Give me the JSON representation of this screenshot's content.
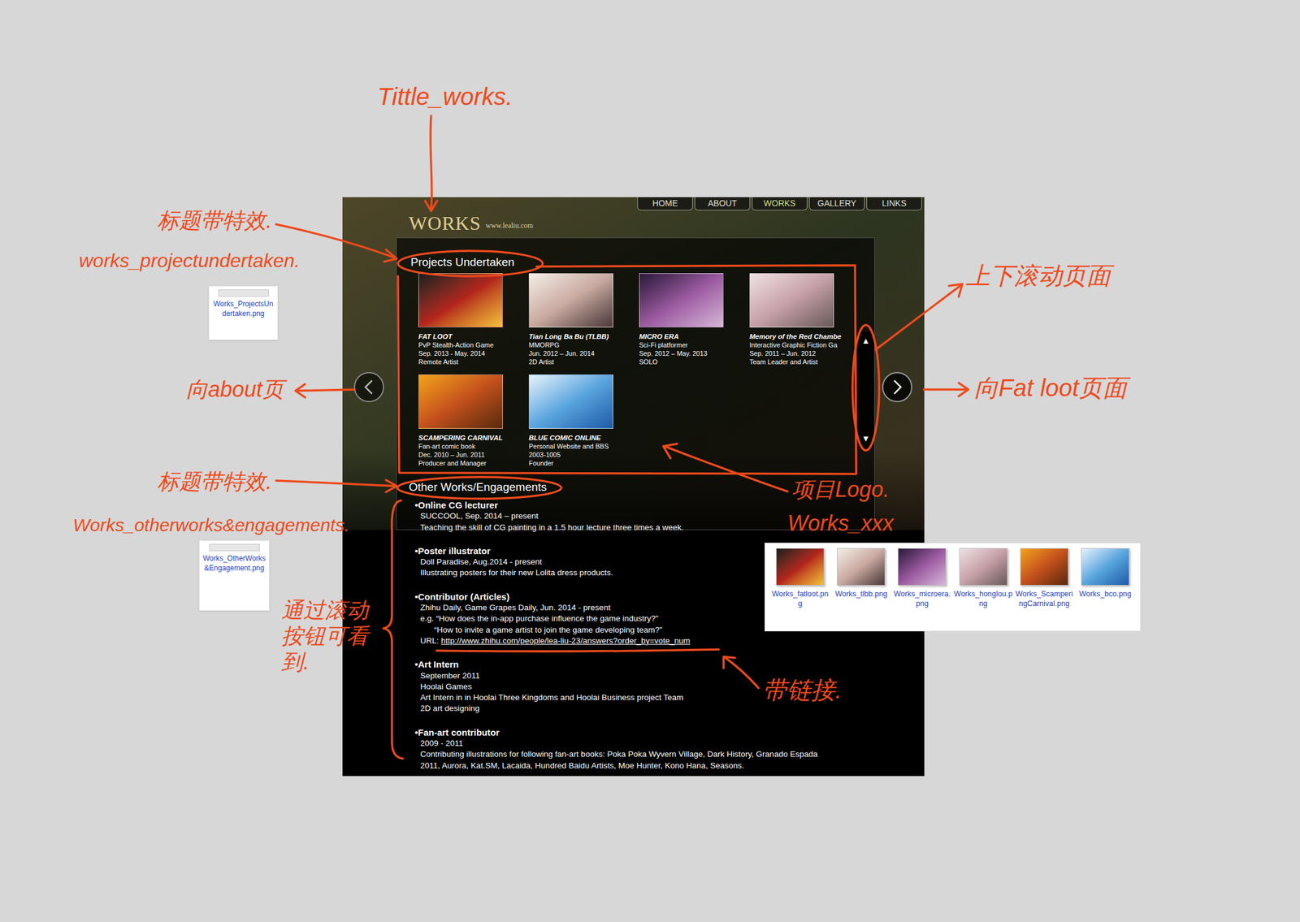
{
  "annotations": [
    {
      "text": "Tittle_works."
    },
    {
      "text": "标题带特效."
    },
    {
      "text": "works_projectundertaken."
    },
    {
      "text": "向about页"
    },
    {
      "text": "标题带特效."
    },
    {
      "text": "Works_otherworks&engagements."
    },
    {
      "text": "通过滚动按钮可看到."
    },
    {
      "text": "带链接."
    },
    {
      "text": "项目Logo."
    },
    {
      "text": "Works_xxx"
    },
    {
      "text": "上下滚动页面"
    },
    {
      "text": "向Fat loot页面"
    }
  ],
  "thumbnails": [
    {
      "label": "Works_ProjectsUndertaken.png"
    },
    {
      "label": "Works_OtherWorks&Engagement.png"
    }
  ],
  "files": [
    {
      "label": "Works_fatloot.png"
    },
    {
      "label": "Works_tlbb.png"
    },
    {
      "label": "Works_microera.png"
    },
    {
      "label": "Works_honglou.png"
    },
    {
      "label": "Works_ScamperingCarnival.png"
    },
    {
      "label": "Works_bco.png"
    }
  ],
  "site": {
    "nav": [
      {
        "label": "HOME",
        "selected": false
      },
      {
        "label": "ABOUT",
        "selected": false
      },
      {
        "label": "WORKS",
        "selected": true
      },
      {
        "label": "GALLERY",
        "selected": false
      },
      {
        "label": "LINKS",
        "selected": false
      }
    ],
    "title": "WORKS",
    "domain": "www.lealiu.com",
    "projects_heading": "Projects Undertaken",
    "projects": [
      {
        "title": "FAT LOOT",
        "lines": [
          "PvP Stealth-Action Game",
          "Sep. 2013 - May. 2014",
          "Remote Artist"
        ]
      },
      {
        "title": "Tian Long Ba Bu (TLBB)",
        "lines": [
          "MMORPG",
          "Jun. 2012 – Jun. 2014",
          "2D Artist"
        ]
      },
      {
        "title": "MICRO ERA",
        "lines": [
          "Sci-Fi platformer",
          "Sep. 2012 – May. 2013",
          "SOLO"
        ]
      },
      {
        "title": "Memory of  the Red Chambe",
        "lines": [
          "Interactive Graphic Fiction Ga",
          "Sep. 2011 – Jun. 2012",
          "Team Leader and Artist"
        ]
      },
      {
        "title": "SCAMPERING CARNIVAL",
        "lines": [
          "Fan-art comic book",
          "Dec. 2010 – Jun. 2011",
          "Producer and Manager"
        ]
      },
      {
        "title": "BLUE COMIC ONLINE",
        "lines": [
          "Personal Website and BBS",
          "2003-1005",
          "Founder"
        ]
      }
    ],
    "scroll": {
      "up": "▲",
      "down": "▼"
    },
    "other_heading": "Other Works/Engagements",
    "other": [
      {
        "bullet": "•",
        "title": "Online CG lecturer",
        "lines": [
          {
            "kind": "plain",
            "text": "SUCCOOL, Sep. 2014 – present"
          },
          {
            "kind": "plain",
            "text": "Teaching the skill of CG painting in a 1.5 hour lecture three times a week."
          }
        ]
      },
      {
        "bullet": "•",
        "title": "Poster illustrator",
        "lines": [
          {
            "kind": "plain",
            "text": "Doll Paradise, Aug.2014 - present"
          },
          {
            "kind": "plain",
            "text": "Illustrating posters for their new Lolita dress products."
          }
        ]
      },
      {
        "bullet": "•",
        "title": "Contributor (Articles)",
        "lines": [
          {
            "kind": "plain",
            "text": "Zhihu Daily, Game Grapes Daily, Jun. 2014 - present"
          },
          {
            "kind": "plain",
            "text": "e.g. “How does the in-app purchase influence the game industry?”"
          },
          {
            "kind": "indent",
            "text": "“How to invite a game artist to join the game developing team?”"
          },
          {
            "kind": "link",
            "text": "URL: ",
            "url": "http://www.zhihu.com/people/lea-liu-23/answers?order_by=vote_num"
          }
        ]
      },
      {
        "bullet": "•",
        "title": "Art Intern",
        "lines": [
          {
            "kind": "plain",
            "text": "September 2011"
          },
          {
            "kind": "plain",
            "text": "Hoolai Games"
          },
          {
            "kind": "plain",
            "text": "Art Intern in in Hoolai Three Kingdoms and Hoolai Business project Team"
          },
          {
            "kind": "plain",
            "text": "2D art designing"
          }
        ]
      },
      {
        "bullet": "•",
        "title": "Fan-art contributor",
        "lines": [
          {
            "kind": "plain",
            "text": "2009 - 2011"
          },
          {
            "kind": "plain",
            "text": "Contributing illustrations for following fan-art books: Poka Poka Wyvern Village, Dark History, Granado Espada"
          },
          {
            "kind": "plain",
            "text": "2011, Aurora, Kat.SM, Lacaida, Hundred Baidu Artists, Moe Hunter, Kono Hana, Seasons."
          }
        ]
      }
    ]
  }
}
